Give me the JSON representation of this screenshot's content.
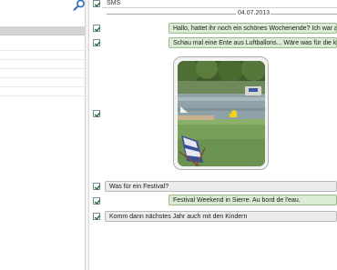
{
  "left_pane": {
    "search_icon": "search-icon",
    "rows": [
      {
        "selected": true
      },
      {
        "selected": false
      },
      {
        "selected": false
      },
      {
        "selected": false
      },
      {
        "selected": false
      },
      {
        "selected": false
      },
      {
        "selected": false
      }
    ]
  },
  "thread": {
    "header_label": "SMS",
    "date": "04.07.2013",
    "messages": [
      {
        "direction": "out",
        "text": "Hallo, hattet ihr noch ein schönes Wochenende? Ich war an",
        "checked": true
      },
      {
        "direction": "out",
        "text": "Schau mal eine Ente aus Luftballons... Wäre was für die kle",
        "checked": true
      },
      {
        "direction": "out",
        "type": "photo",
        "photo_icon": "photo-duck-balloon-lake",
        "checked": true
      },
      {
        "direction": "in",
        "text": "Was für ein Festival?",
        "checked": true
      },
      {
        "direction": "out",
        "text": "Festival Weekend in Sierre. Au bord de l'eau.",
        "checked": true
      },
      {
        "direction": "in",
        "text": "Komm dann nächstes Jahr auch mit den Kindern",
        "checked": true
      }
    ]
  },
  "colors": {
    "outgoing_bubble": "#dcecd4",
    "incoming_bubble": "#ececec",
    "checkbox_check": "#1f6f3a",
    "search_icon": "#2f6fb5"
  }
}
